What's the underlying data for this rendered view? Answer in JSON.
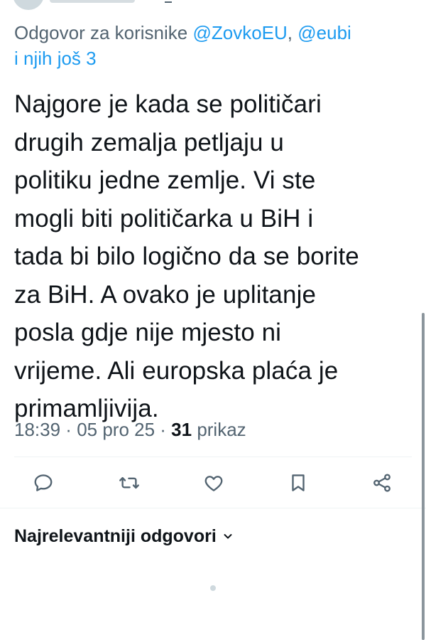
{
  "reply_context": {
    "prefix": "Odgovor za korisnike",
    "handles": [
      "@ZovkoEU",
      "@eubi"
    ],
    "separator": ", ",
    "suffix": "i njih još 3"
  },
  "tweet": {
    "lines": [
      "Najgore je kada se političari",
      "drugih zemalja petljaju u",
      "politiku jedne zemlje. Vi ste",
      "mogli biti političarka u BiH i",
      "tada bi bilo logično da se borite",
      "za BiH. A ovako je uplitanje",
      "posla gdje nije mjesto ni",
      "vrijeme. Ali europska plaća je",
      "primamljivija."
    ]
  },
  "meta": {
    "time": "18:39",
    "dot1": " · ",
    "date": "05 pro 25",
    "dot2": " · ",
    "views_count": "31",
    "views_label": " prikaz"
  },
  "actions": {
    "icons": [
      "reply-icon",
      "retweet-icon",
      "like-icon",
      "bookmark-icon",
      "share-icon"
    ],
    "icon_color": "#536471"
  },
  "replies_sort": {
    "label": "Najrelevantniji odgovori"
  },
  "colors": {
    "text": "#0f1419",
    "secondary": "#536471",
    "link": "#1d9bf0",
    "divider": "#eff3f4"
  }
}
